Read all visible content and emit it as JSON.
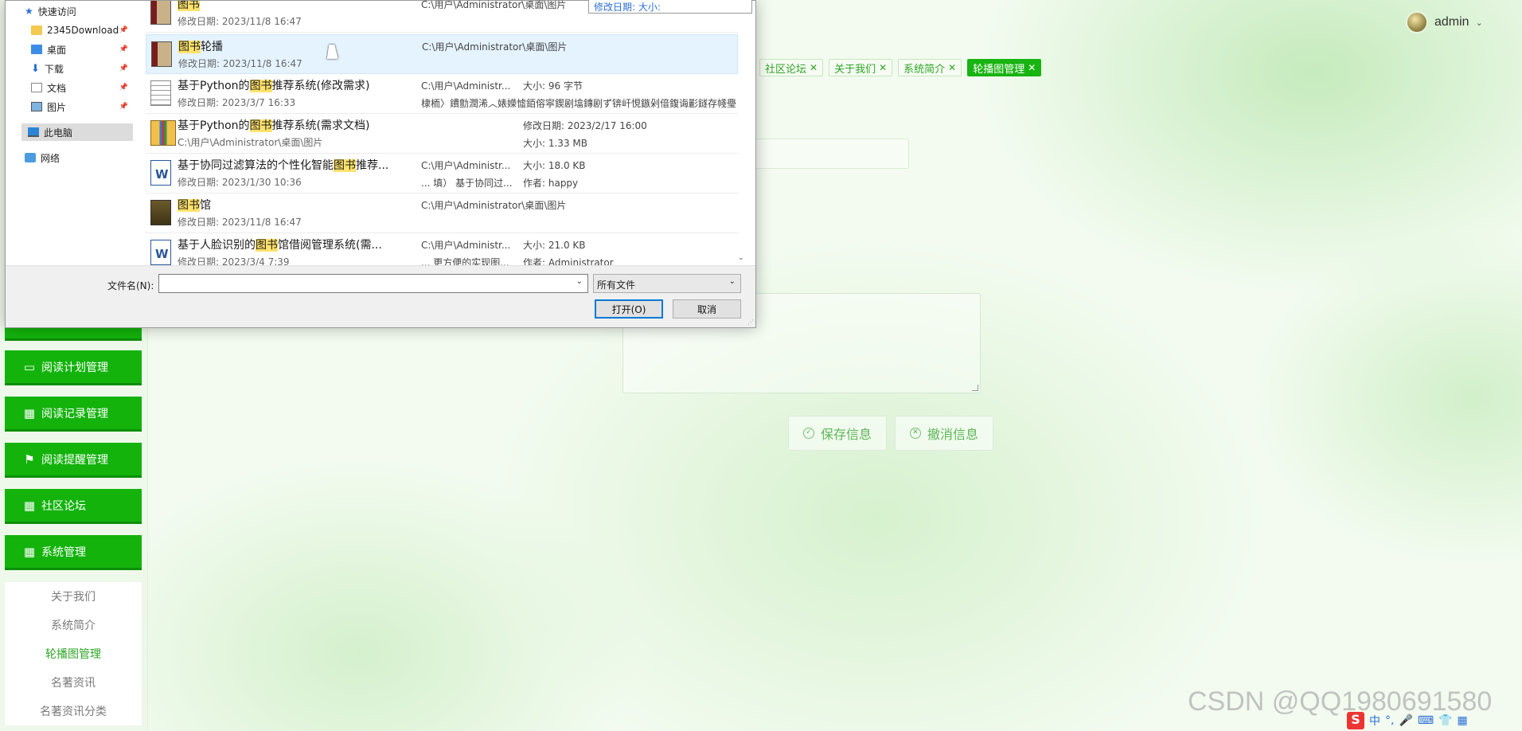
{
  "header": {
    "username": "admin"
  },
  "tags": [
    {
      "label": "社区论坛",
      "active": false
    },
    {
      "label": "关于我们",
      "active": false
    },
    {
      "label": "系统简介",
      "active": false
    },
    {
      "label": "轮播图管理",
      "active": true
    }
  ],
  "form": {
    "save_label": "保存信息",
    "cancel_label": "撤消信息"
  },
  "sidebar": {
    "menu": [
      {
        "label": "阅读计划管理",
        "icon": "monitor-icon"
      },
      {
        "label": "阅读记录管理",
        "icon": "grid-icon"
      },
      {
        "label": "阅读提醒管理",
        "icon": "flag-icon"
      },
      {
        "label": "社区论坛",
        "icon": "grid-icon"
      },
      {
        "label": "系统管理",
        "icon": "grid-icon"
      }
    ],
    "submenu": [
      {
        "label": "关于我们",
        "active": false
      },
      {
        "label": "系统简介",
        "active": false
      },
      {
        "label": "轮播图管理",
        "active": true
      },
      {
        "label": "名著资讯",
        "active": false
      },
      {
        "label": "名著资讯分类",
        "active": false
      }
    ]
  },
  "dialog": {
    "tooltip": "修改日期:    大小:",
    "nav": [
      {
        "label": "快速访问",
        "icon": "star-icon",
        "pinned": false
      },
      {
        "label": "2345Download",
        "icon": "folder-icon",
        "pinned": true
      },
      {
        "label": "桌面",
        "icon": "desktop-icon",
        "pinned": true
      },
      {
        "label": "下载",
        "icon": "download-icon",
        "pinned": true
      },
      {
        "label": "文档",
        "icon": "documents-icon",
        "pinned": true
      },
      {
        "label": "图片",
        "icon": "pictures-icon",
        "pinned": true
      },
      {
        "label": "此电脑",
        "icon": "computer-icon",
        "pinned": false
      },
      {
        "label": "网络",
        "icon": "network-icon",
        "pinned": false
      }
    ],
    "files": [
      {
        "pre": "",
        "hl": "图书",
        "post": "",
        "meta": "修改日期: 2023/11/8 16:47",
        "col1": "C:\\用户\\Administrator\\桌面\\图片",
        "col1b": "",
        "col2": "",
        "col2b": "",
        "icon": "book-folder-icon"
      },
      {
        "pre": "",
        "hl": "图书",
        "post": "轮播",
        "meta": "修改日期: 2023/11/8 16:47",
        "col1": "C:\\用户\\Administrator\\桌面\\图片",
        "col1b": "",
        "col2": "",
        "col2b": "",
        "icon": "book-folder-icon"
      },
      {
        "pre": "基于Python的",
        "hl": "图书",
        "post": "推荐系统(修改需求)",
        "meta": "修改日期: 2023/3/7 16:33",
        "col1": "C:\\用户\\Administr...",
        "col1b": "棣栭〉鐨勯潤浠︿婊嬫憈銆傛寜鍥剧墖鏄剧ず锛屽悓鏃剁偣鍑诲彲鐩存帴璺宠浆鍒扮浉鍏冲浘涔﹁鎯...",
        "col2": "大小: 96 字节",
        "col2b": "",
        "icon": "text-file-icon"
      },
      {
        "pre": "基于Python的",
        "hl": "图书",
        "post": "推荐系统(需求文档)",
        "meta": "C:\\用户\\Administrator\\桌面\\图片",
        "col1": "",
        "col1b": "",
        "col2": "修改日期: 2023/2/17 16:00",
        "col2b": "大小: 1.33 MB",
        "icon": "archive-icon"
      },
      {
        "pre": "基于协同过滤算法的个性化智能",
        "hl": "图书",
        "post": "推荐...",
        "meta": "修改日期: 2023/1/30 10:36",
        "col1": "C:\\用户\\Administr...",
        "col1b": "... 填） 基于协同过...",
        "col2": "大小: 18.0 KB",
        "col2b": "作者: happy",
        "icon": "word-doc-icon"
      },
      {
        "pre": "",
        "hl": "图书",
        "post": "馆",
        "meta": "修改日期: 2023/11/8 16:47",
        "col1": "C:\\用户\\Administrator\\桌面\\图片",
        "col1b": "",
        "col2": "",
        "col2b": "",
        "icon": "library-folder-icon"
      },
      {
        "pre": "基于人脸识别的",
        "hl": "图书",
        "post": "馆借阅管理系统(需...",
        "meta": "修改日期: 2023/3/4 7:39",
        "col1": "C:\\用户\\Administr...",
        "col1b": "... 更方便的实现图...",
        "col2": "大小: 21.0 KB",
        "col2b": "作者: Administrator",
        "icon": "word-doc-icon"
      }
    ],
    "filename_label": "文件名(N):",
    "filename_value": "",
    "filetype": "所有文件",
    "open_label": "打开(O)",
    "cancel_label": "取消"
  },
  "watermark": "CSDN @QQ1980691580",
  "tray": {
    "ime": "中"
  }
}
